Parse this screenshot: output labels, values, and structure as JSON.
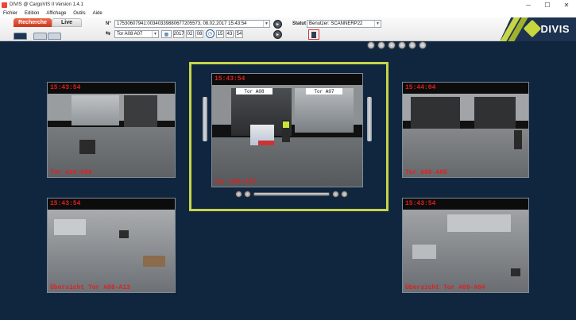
{
  "window": {
    "title": "DIVIS @ CargoVIS II Version 1.4.1",
    "min_glyph": "─",
    "max_glyph": "☐",
    "close_glyph": "✕"
  },
  "menu": [
    "Fichier",
    "Edition",
    "Affichage",
    "Outils",
    "Aide"
  ],
  "tabs": {
    "recherche": "Recherche",
    "live": "Live"
  },
  "search": {
    "number_label": "N°",
    "number_value": "17530607941:0034033988067720557​3, 08.02.2017 15:43:54",
    "gate_value": "Tor A08 A07",
    "date": {
      "year": "2017",
      "month": "02",
      "day": "08"
    },
    "time": {
      "hour": "15",
      "minute": "43",
      "second": "54"
    },
    "statut_label": "Statut",
    "statut_value": "Benutzer: SCANNERP22"
  },
  "logo": {
    "text": "DIVIS",
    "accent_color": "#c6d54a"
  },
  "cameras": [
    {
      "id": "left-top",
      "time": "15:43:54",
      "name": "Tor A10-A09"
    },
    {
      "id": "center",
      "time": "15:43:54",
      "name": "Tor A08-A07",
      "sign_left": "Tor A08",
      "sign_right": "Tor A07"
    },
    {
      "id": "right-top",
      "time": "15:44:04",
      "name": "Tor A06-A05"
    },
    {
      "id": "left-bottom",
      "time": "15:43:54",
      "name": "Übersicht Tor A08-A13"
    },
    {
      "id": "right-bottom",
      "time": "15:43:54",
      "name": "Übersicht Tor A09-A04"
    }
  ],
  "colors": {
    "background": "#10263f",
    "timestamp": "#e02020",
    "highlight": "#c6d54a",
    "recherche_tab": "#d8462a"
  }
}
